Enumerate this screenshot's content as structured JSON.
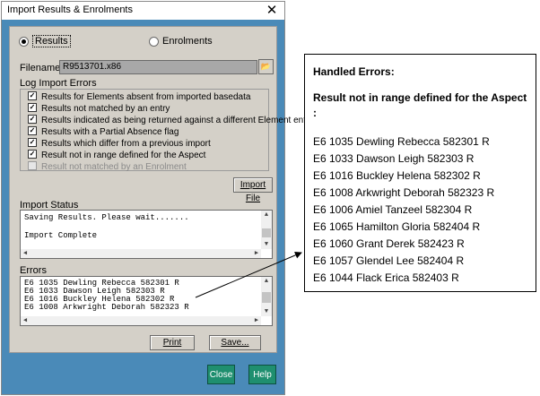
{
  "window": {
    "title": "Import Results & Enrolments",
    "close_glyph": "✕"
  },
  "mode": {
    "results_label": "Results",
    "enrolments_label": "Enrolments",
    "selected": "Results"
  },
  "filename": {
    "label": "Filename",
    "value": "R9513701.x86"
  },
  "log": {
    "label": "Log Import Errors",
    "items": [
      {
        "label": "Results for Elements absent from imported basedata",
        "checked": true,
        "enabled": true
      },
      {
        "label": "Results not matched by an entry",
        "checked": true,
        "enabled": true
      },
      {
        "label": "Results indicated as being returned against a different Element entry",
        "checked": true,
        "enabled": true
      },
      {
        "label": "Results with a Partial Absence flag",
        "checked": true,
        "enabled": true
      },
      {
        "label": "Results which differ from a previous import",
        "checked": true,
        "enabled": true
      },
      {
        "label": "Result not in range defined for the Aspect",
        "checked": true,
        "enabled": true
      },
      {
        "label": "Result not matched by an Enrolment",
        "checked": false,
        "enabled": false
      }
    ]
  },
  "buttons": {
    "import_file": "Import File",
    "print": "Print",
    "save": "Save...",
    "close": "Close",
    "help": "Help"
  },
  "status": {
    "label": "Import Status",
    "line1": "Saving Results. Please wait.......",
    "line2": "Import Complete"
  },
  "errors": {
    "label": "Errors",
    "lines": [
      "E6 1035  Dewling Rebecca  582301  R",
      "E6 1033  Dawson Leigh  582303  R",
      "E6 1016  Buckley Helena  582302  R",
      "E6 1008  Arkwright Deborah  582323  R"
    ]
  },
  "callout": {
    "title": "Handled Errors:",
    "subtitle": "Result not in range defined for the Aspect :",
    "rows": [
      "E6 1035  Dewling Rebecca  582301  R",
      "E6 1033  Dawson Leigh  582303  R",
      "E6 1016  Buckley Helena  582302  R",
      "E6 1008  Arkwright Deborah  582323  R",
      "E6 1006  Amiel Tanzeel  582304  R",
      "E6 1065  Hamilton Gloria  582404  R",
      "E6 1060  Grant Derek  582423  R",
      "E6 1057  Glendel Lee  582404  R",
      "E6 1044  Flack Erica  582403  R"
    ]
  },
  "colors": {
    "window_bg": "#4a8ab8",
    "panel_bg": "#d4d0c8",
    "accent_button": "#1f8f6f"
  }
}
